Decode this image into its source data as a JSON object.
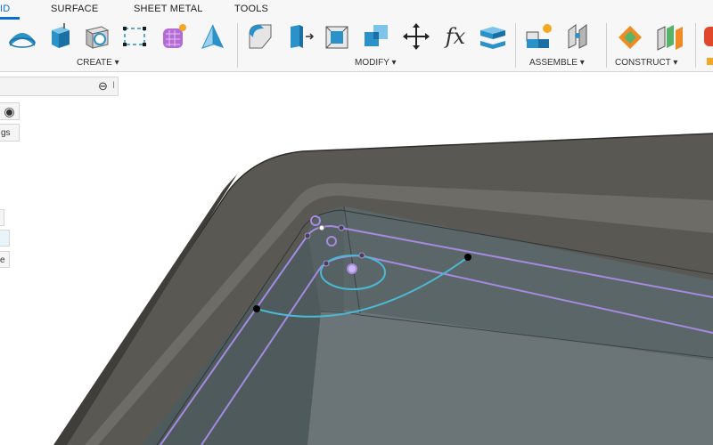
{
  "tabs": [
    {
      "label": "ID",
      "active": true
    },
    {
      "label": "SURFACE"
    },
    {
      "label": "SHEET METAL"
    },
    {
      "label": "TOOLS"
    }
  ],
  "groups": {
    "create": "CREATE ▾",
    "modify": "MODIFY ▾",
    "assemble": "ASSEMBLE ▾",
    "construct": "CONSTRUCT ▾"
  },
  "tools": {
    "create": [
      "revolve-icon",
      "extrude-box-icon",
      "hole-icon",
      "sketch-rectangle-icon",
      "form-icon",
      "pyramid-icon"
    ],
    "modify": [
      "fillet-icon",
      "press-pull-icon",
      "shell-icon",
      "combine-icon",
      "move-icon",
      "parameters-fx-icon",
      "align-faces-icon"
    ],
    "assemble": [
      "new-component-icon",
      "joint-icon"
    ],
    "construct": [
      "offset-plane-icon",
      "midplane-icon"
    ]
  },
  "fx_label": "fx",
  "browser": {
    "collapse": "⊖",
    "partial": "I"
  },
  "panel": {
    "radio": "◉",
    "settings_partial": "gs",
    "item_partial": "e"
  },
  "colors": {
    "accent": "#0a6ed1",
    "body": "#5e5c57",
    "sketch": "#a58ae0",
    "arc": "#4bb8d4"
  }
}
